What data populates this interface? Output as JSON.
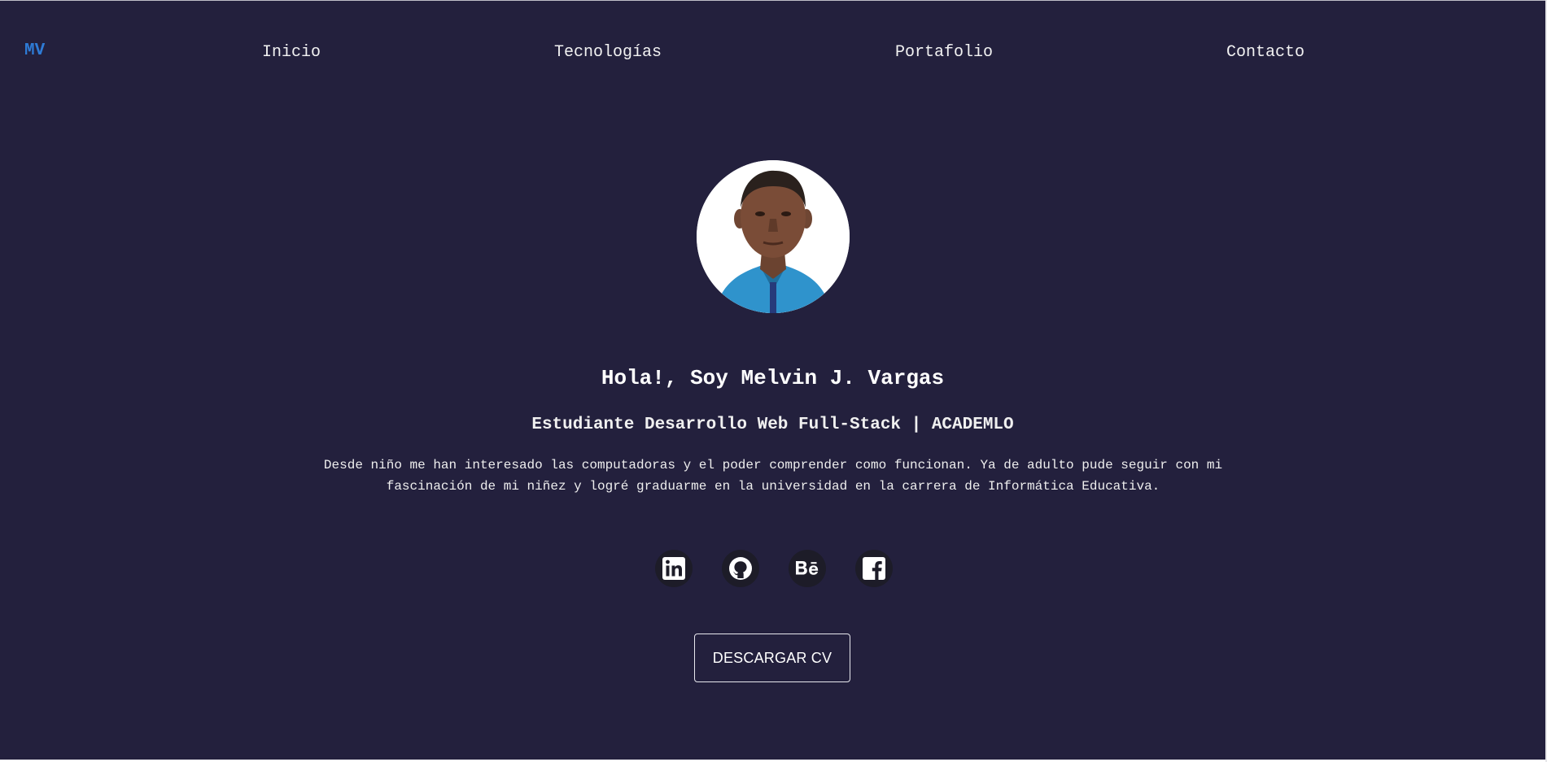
{
  "nav": {
    "logo": "MV",
    "links": [
      {
        "label": "Inicio"
      },
      {
        "label": "Tecnologías"
      },
      {
        "label": "Portafolio"
      },
      {
        "label": "Contacto"
      }
    ]
  },
  "hero": {
    "title": "Hola!, Soy Melvin J. Vargas",
    "subtitle": "Estudiante Desarrollo Web Full-Stack | ACADEMLO",
    "bio_line1": "Desde niño me han interesado las computadoras y el poder comprender como funcionan. Ya de adulto pude seguir con mi",
    "bio_line2": "fascinación de mi niñez y logré graduarme en la universidad en la carrera de Informática Educativa."
  },
  "social": {
    "icons": [
      "linkedin-icon",
      "github-icon",
      "behance-icon",
      "facebook-icon"
    ]
  },
  "cv_button": {
    "label": "DESCARGAR CV"
  },
  "colors": {
    "background": "#23203d",
    "accent": "#2e7bd6",
    "text": "#ffffff",
    "icon_circle": "#1d1c28"
  }
}
